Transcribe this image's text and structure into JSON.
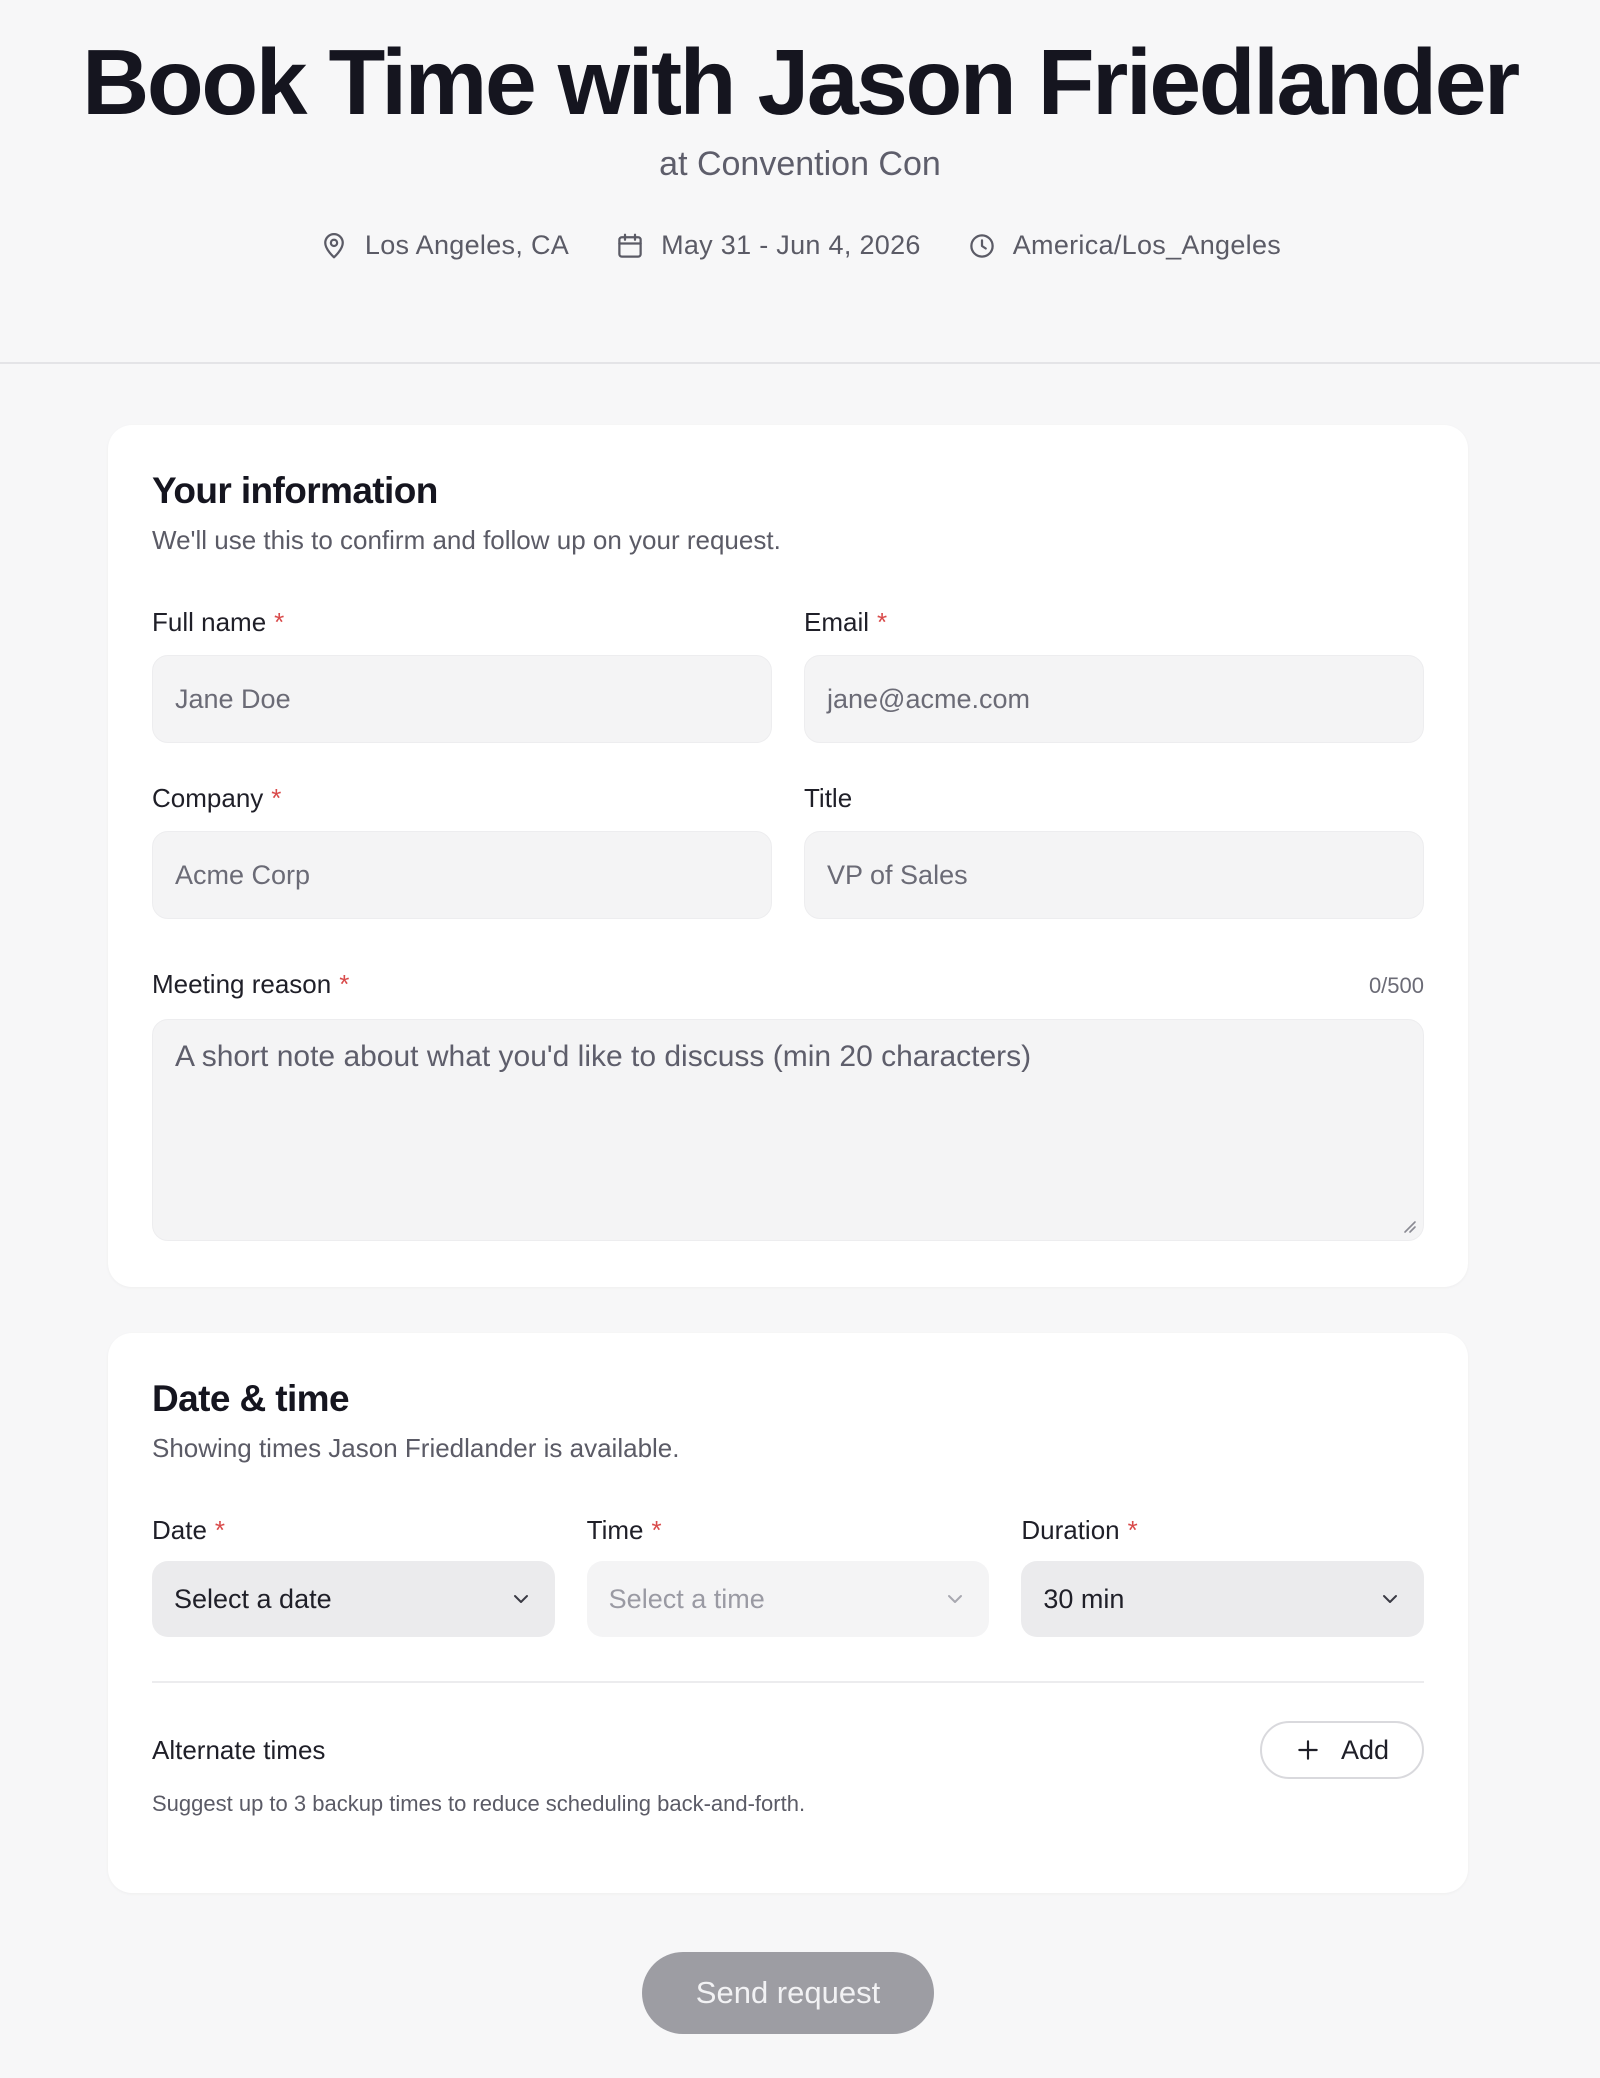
{
  "header": {
    "title": "Book Time with Jason Friedlander",
    "subtitle": "at Convention Con",
    "location": "Los Angeles, CA",
    "dates": "May 31 - Jun 4, 2026",
    "timezone": "America/Los_Angeles"
  },
  "info_section": {
    "title": "Your information",
    "description": "We'll use this to confirm and follow up on your request.",
    "full_name": {
      "label": "Full name",
      "required": "*",
      "placeholder": "Jane Doe"
    },
    "email": {
      "label": "Email",
      "required": "*",
      "placeholder": "jane@acme.com"
    },
    "company": {
      "label": "Company",
      "required": "*",
      "placeholder": "Acme Corp"
    },
    "job_title": {
      "label": "Title",
      "placeholder": "VP of Sales"
    },
    "meeting_reason": {
      "label": "Meeting reason",
      "required": "*",
      "counter": "0/500",
      "placeholder": "A short note about what you'd like to discuss (min 20 characters)"
    }
  },
  "datetime_section": {
    "title": "Date & time",
    "description": "Showing times Jason Friedlander is available.",
    "date": {
      "label": "Date",
      "required": "*",
      "value": "Select a date"
    },
    "time": {
      "label": "Time",
      "required": "*",
      "value": "Select a time"
    },
    "duration": {
      "label": "Duration",
      "required": "*",
      "value": "30 min"
    },
    "alternate": {
      "title": "Alternate times",
      "add_label": "Add",
      "description": "Suggest up to 3 backup times to reduce scheduling back-and-forth."
    }
  },
  "submit": {
    "label": "Send request"
  },
  "colors": {
    "required": "#d94a4a",
    "submit_disabled": "#9d9da3"
  }
}
